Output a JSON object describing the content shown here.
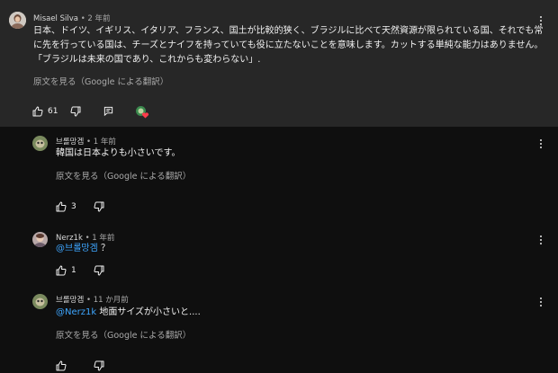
{
  "main_comment": {
    "author": "Misael Silva",
    "timestamp": "2 年前",
    "lines": [
      "日本、ドイツ、イギリス、イタリア、フランス、国土が比較的狭く、ブラジルに比べて天然資源が限られている国、それでも常",
      "に先を行っている国は、チーズとナイフを持っていても役に立たないことを意味します。カットする単純な能力はありません。",
      "「ブラジルは未来の国であり、これからも変わらない」."
    ],
    "translate_label": "原文を見る（Google による翻訳）",
    "like_count": "61"
  },
  "replies": [
    {
      "author": "브롤망겜",
      "timestamp": "1 年前",
      "mention": "",
      "text": "韓国は日本よりも小さいです。",
      "translate_label": "原文を見る（Google による翻訳）",
      "like_count": "3"
    },
    {
      "author": "Nerz1k",
      "timestamp": "1 年前",
      "mention": "@브롤망겜",
      "text": "？",
      "translate_label": "",
      "like_count": "1"
    },
    {
      "author": "브롤망겜",
      "timestamp": "11 か月前",
      "mention": "@Nerz1k",
      "text": "地面サイズが小さいと....",
      "translate_label": "原文を見る（Google による翻訳）",
      "like_count": ""
    }
  ],
  "colors": {
    "background": "#0f0f0f",
    "highlighted_comment": "#272727",
    "mention": "#3ea6ff",
    "secondary_text": "#aaaaaa"
  },
  "icons": [
    "thumb-up-icon",
    "thumb-down-icon",
    "reply-icon",
    "creator-heart-icon",
    "more-vert-icon"
  ]
}
